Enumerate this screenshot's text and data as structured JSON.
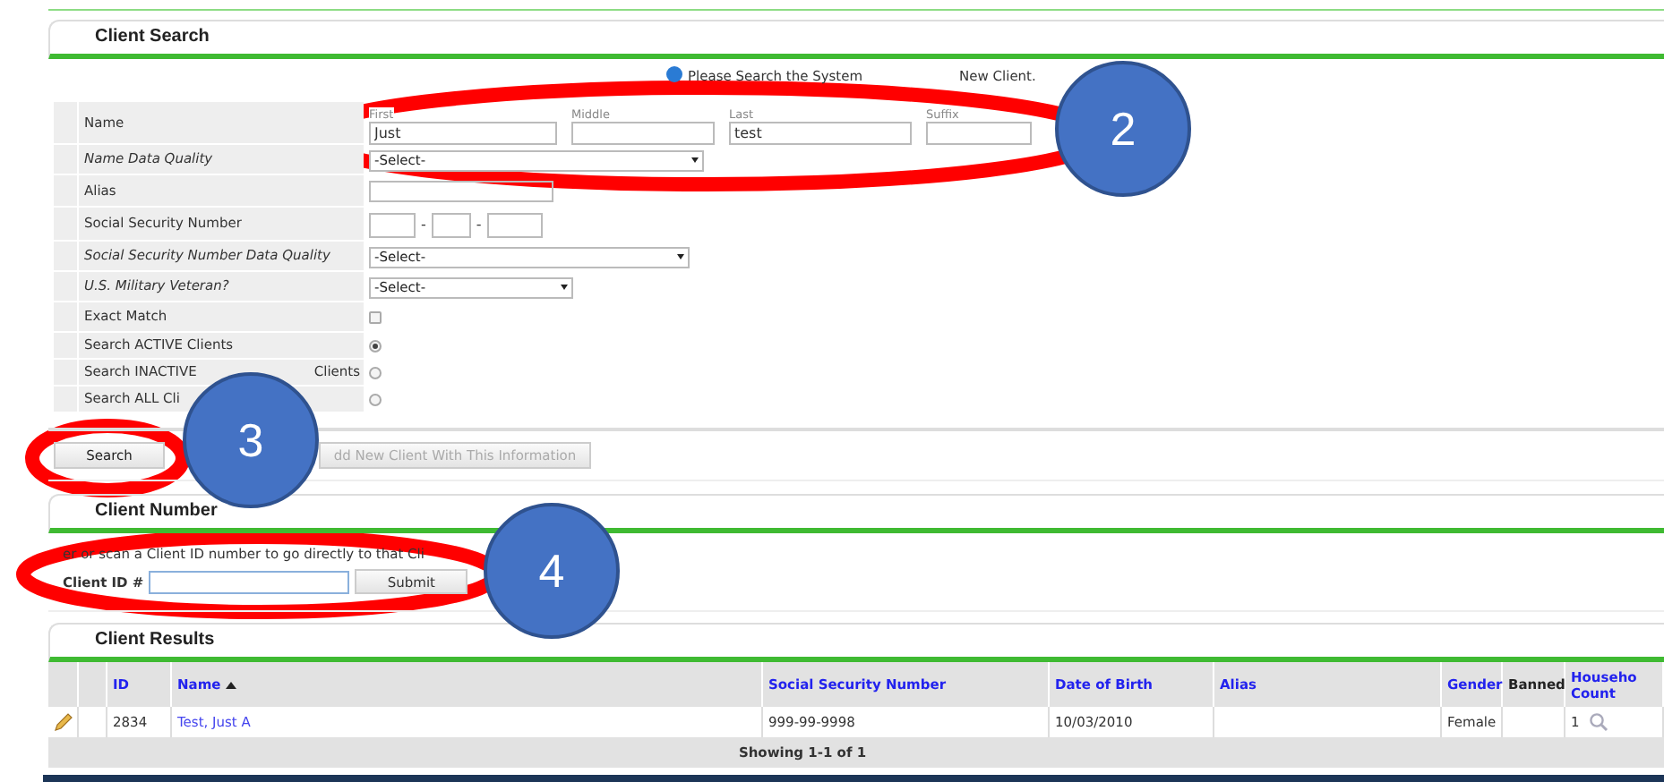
{
  "client_search": {
    "title": "Client Search",
    "notice": [
      "Please Search the System",
      "New Client."
    ],
    "rows": [
      {
        "kind": "name",
        "label": "Name",
        "emphasis": false,
        "parts": [
          {
            "label": "First",
            "value": "Just"
          },
          {
            "label": "Middle"
          },
          {
            "label": "Last",
            "value": "test"
          },
          {
            "label": "Suffix"
          }
        ]
      },
      {
        "kind": "select",
        "label": "Name Data Quality",
        "emphasis": true,
        "value": "-Select-"
      },
      {
        "kind": "text",
        "label": "Alias",
        "emphasis": false
      },
      {
        "kind": "ssn",
        "label": "Social Security Number",
        "emphasis": false,
        "separators": [
          "-",
          "-"
        ]
      },
      {
        "kind": "select",
        "label": "Social Security Number Data Quality",
        "emphasis": true,
        "value": "-Select-"
      },
      {
        "kind": "select",
        "label": "U.S. Military Veteran?",
        "emphasis": true,
        "value": "-Select-"
      },
      {
        "kind": "checkbox",
        "label": "Exact Match",
        "emphasis": false,
        "checked": false
      },
      {
        "kind": "radio",
        "label": "Search ACTIVE Clients",
        "emphasis": false,
        "selected": true
      },
      {
        "kind": "radio",
        "label": "Search INACTIVE",
        "label_end": "Clients",
        "emphasis": false,
        "selected": false
      },
      {
        "kind": "radio",
        "label": "Search ALL Cli",
        "emphasis": false,
        "selected": false
      }
    ],
    "buttons": [
      {
        "label": "Search",
        "disabled": false
      },
      {
        "label": "dd New Client With This Information",
        "disabled": true
      }
    ]
  },
  "client_number": {
    "title": "Client Number",
    "hint": "er or scan a Client ID number to go directly to that Cli",
    "field_label": "Client ID #",
    "button": "Submit"
  },
  "client_results": {
    "title": "Client Results",
    "columns": [
      {
        "label": "ID",
        "link": true
      },
      {
        "label": "Name",
        "link": true,
        "sorted": true
      },
      {
        "label": "Social Security Number",
        "link": true
      },
      {
        "label": "Date of Birth",
        "link": true
      },
      {
        "label": "Alias",
        "link": true
      },
      {
        "label": "Gender",
        "link": true
      },
      {
        "label": "Banned",
        "link": false
      },
      {
        "label": "Househo Count",
        "link": true
      }
    ],
    "rows": [
      {
        "cells": [
          "2834",
          "Test, Just A",
          "999-99-9998",
          "10/03/2010",
          "",
          "Female",
          "",
          "1"
        ]
      }
    ],
    "footer": "Showing 1-1 of 1"
  },
  "annotations": [
    {
      "number": "2"
    },
    {
      "number": "3"
    },
    {
      "number": "4"
    }
  ]
}
